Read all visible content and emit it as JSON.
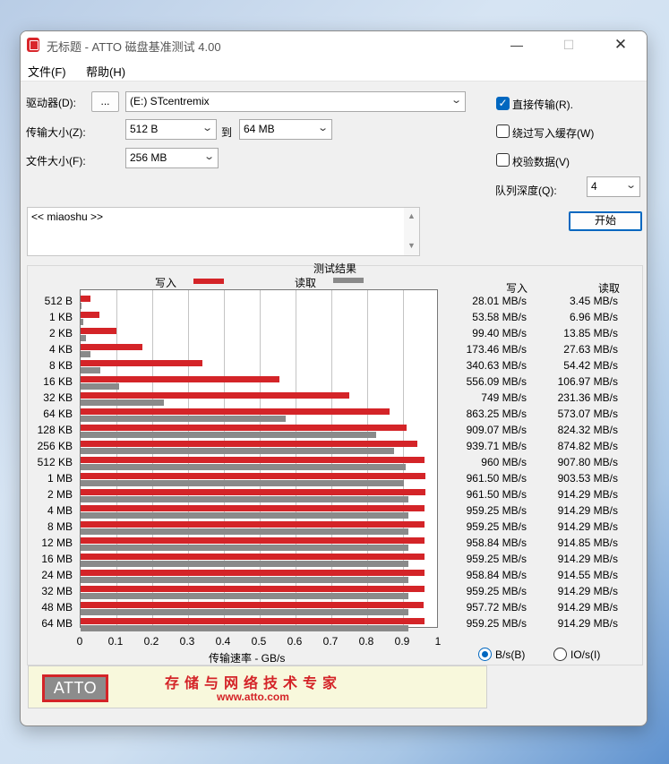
{
  "window": {
    "title": "无标题 - ATTO 磁盘基准测试 4.00",
    "controls": {
      "minimize": "—",
      "maximize": "☐",
      "close": "✕"
    }
  },
  "menu": [
    "文件(F)",
    "帮助(H)"
  ],
  "settings": {
    "drive_label": "驱动器(D):",
    "browse_label": "...",
    "drive_value": "(E:) STcentremix",
    "transfer_label": "传输大小(Z):",
    "transfer_from": "512 B",
    "to_label": "到",
    "transfer_to": "64 MB",
    "file_size_label": "文件大小(F):",
    "file_size": "256 MB",
    "direct_io_label": "直接传输(R).",
    "direct_io_checked": true,
    "bypass_cache_label": "绕过写入缓存(W)",
    "bypass_cache_checked": false,
    "verify_label": "校验数据(V)",
    "verify_checked": false,
    "queue_label": "队列深度(Q):",
    "queue_depth": "4",
    "start_label": "开始"
  },
  "description": "<< miaoshu >>",
  "results": {
    "title": "测试结果",
    "legend_write": "写入",
    "legend_read": "读取",
    "col_write": "写入",
    "col_read": "读取",
    "rows": [
      {
        "size": "512 B",
        "write": "28.01 MB/s",
        "read": "3.45 MB/s"
      },
      {
        "size": "1 KB",
        "write": "53.58 MB/s",
        "read": "6.96 MB/s"
      },
      {
        "size": "2 KB",
        "write": "99.40 MB/s",
        "read": "13.85 MB/s"
      },
      {
        "size": "4 KB",
        "write": "173.46 MB/s",
        "read": "27.63 MB/s"
      },
      {
        "size": "8 KB",
        "write": "340.63 MB/s",
        "read": "54.42 MB/s"
      },
      {
        "size": "16 KB",
        "write": "556.09 MB/s",
        "read": "106.97 MB/s"
      },
      {
        "size": "32 KB",
        "write": "749 MB/s",
        "read": "231.36 MB/s"
      },
      {
        "size": "64 KB",
        "write": "863.25 MB/s",
        "read": "573.07 MB/s"
      },
      {
        "size": "128 KB",
        "write": "909.07 MB/s",
        "read": "824.32 MB/s"
      },
      {
        "size": "256 KB",
        "write": "939.71 MB/s",
        "read": "874.82 MB/s"
      },
      {
        "size": "512 KB",
        "write": "960 MB/s",
        "read": "907.80 MB/s"
      },
      {
        "size": "1 MB",
        "write": "961.50 MB/s",
        "read": "903.53 MB/s"
      },
      {
        "size": "2 MB",
        "write": "961.50 MB/s",
        "read": "914.29 MB/s"
      },
      {
        "size": "4 MB",
        "write": "959.25 MB/s",
        "read": "914.29 MB/s"
      },
      {
        "size": "8 MB",
        "write": "959.25 MB/s",
        "read": "914.29 MB/s"
      },
      {
        "size": "12 MB",
        "write": "958.84 MB/s",
        "read": "914.85 MB/s"
      },
      {
        "size": "16 MB",
        "write": "959.25 MB/s",
        "read": "914.29 MB/s"
      },
      {
        "size": "24 MB",
        "write": "958.84 MB/s",
        "read": "914.55 MB/s"
      },
      {
        "size": "32 MB",
        "write": "959.25 MB/s",
        "read": "914.29 MB/s"
      },
      {
        "size": "48 MB",
        "write": "957.72 MB/s",
        "read": "914.29 MB/s"
      },
      {
        "size": "64 MB",
        "write": "959.25 MB/s",
        "read": "914.29 MB/s"
      }
    ],
    "xlabel": "传输速率 - GB/s",
    "unit_bytes_label": "B/s(B)",
    "unit_bytes_selected": true,
    "unit_io_label": "IO/s(I)",
    "unit_io_selected": false
  },
  "chart_data": {
    "type": "bar",
    "orientation": "horizontal",
    "categories": [
      "512 B",
      "1 KB",
      "2 KB",
      "4 KB",
      "8 KB",
      "16 KB",
      "32 KB",
      "64 KB",
      "128 KB",
      "256 KB",
      "512 KB",
      "1 MB",
      "2 MB",
      "4 MB",
      "8 MB",
      "12 MB",
      "16 MB",
      "24 MB",
      "32 MB",
      "48 MB",
      "64 MB"
    ],
    "series": [
      {
        "name": "写入",
        "color": "#d42428",
        "values": [
          0.02801,
          0.05358,
          0.0994,
          0.17346,
          0.34063,
          0.55609,
          0.749,
          0.86325,
          0.90907,
          0.93971,
          0.96,
          0.9615,
          0.9615,
          0.95925,
          0.95925,
          0.95884,
          0.95925,
          0.95884,
          0.95925,
          0.95772,
          0.95925
        ]
      },
      {
        "name": "读取",
        "color": "#8a8a8a",
        "values": [
          0.00345,
          0.00696,
          0.01385,
          0.02763,
          0.05442,
          0.10697,
          0.23136,
          0.57307,
          0.82432,
          0.87482,
          0.9078,
          0.90353,
          0.91429,
          0.91429,
          0.91429,
          0.91485,
          0.91429,
          0.91455,
          0.91429,
          0.91429,
          0.91429
        ]
      }
    ],
    "xlim": [
      0,
      1
    ],
    "xticks": [
      "0",
      "0.1",
      "0.2",
      "0.3",
      "0.4",
      "0.5",
      "0.6",
      "0.7",
      "0.8",
      "0.9",
      "1"
    ],
    "xlabel": "传输速率 - GB/s",
    "grid": true
  },
  "banner": {
    "logo_text": "ATTO",
    "slogan": "存储与网络技术专家",
    "website": "www.atto.com"
  }
}
